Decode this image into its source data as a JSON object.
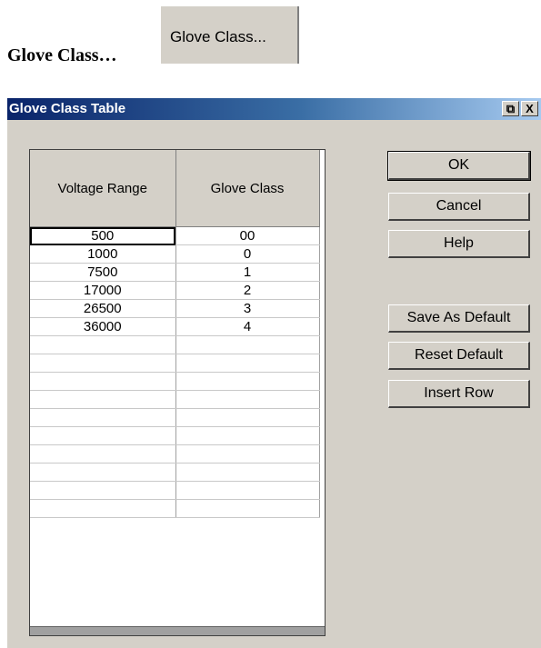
{
  "caption": "Glove Class…",
  "launcher_button_label": "Glove Class...",
  "dialog": {
    "title": "Glove Class Table",
    "restore_glyph": "⧉",
    "close_glyph": "X"
  },
  "grid": {
    "columns": [
      "Voltage Range",
      "Glove Class"
    ],
    "rows": [
      [
        "500",
        "00"
      ],
      [
        "1000",
        "0"
      ],
      [
        "7500",
        "1"
      ],
      [
        "17000",
        "2"
      ],
      [
        "26500",
        "3"
      ],
      [
        "36000",
        "4"
      ],
      [
        "",
        ""
      ],
      [
        "",
        ""
      ],
      [
        "",
        ""
      ],
      [
        "",
        ""
      ],
      [
        "",
        ""
      ],
      [
        "",
        ""
      ],
      [
        "",
        ""
      ],
      [
        "",
        ""
      ],
      [
        "",
        ""
      ],
      [
        "",
        ""
      ]
    ]
  },
  "buttons": {
    "ok": "OK",
    "cancel": "Cancel",
    "help": "Help",
    "save_default": "Save As Default",
    "reset_default": "Reset Default",
    "insert_row": "Insert Row"
  }
}
